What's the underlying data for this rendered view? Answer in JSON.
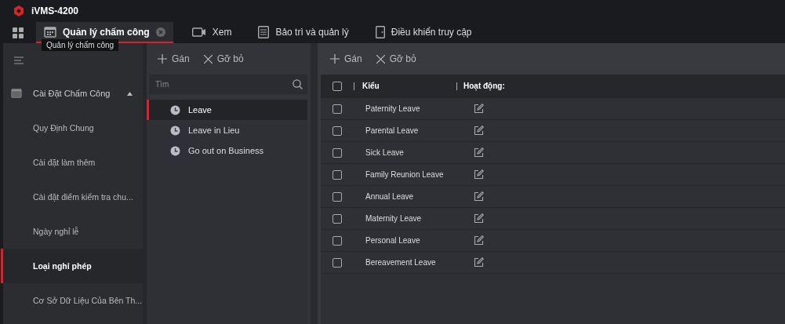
{
  "window": {
    "title": "iVMS-4200"
  },
  "tabs": [
    {
      "label": "Quản lý chấm công",
      "selected": true,
      "closable": true
    },
    {
      "label": "Xem",
      "selected": false,
      "closable": false
    },
    {
      "label": "Bảo trì và quản lý",
      "selected": false,
      "closable": false
    },
    {
      "label": "Điều khiển truy cập",
      "selected": false,
      "closable": false
    }
  ],
  "tooltip": "Quản lý chấm công",
  "sidebar": {
    "group": {
      "label": "Cài Đặt Chấm Công",
      "expanded": true,
      "children": [
        {
          "label": "Quy Định Chung",
          "selected": false
        },
        {
          "label": "Cài đặt làm thêm",
          "selected": false
        },
        {
          "label": "Cài đặt điểm kiểm tra chu...",
          "selected": false
        },
        {
          "label": "Ngày nghỉ lễ",
          "selected": false
        },
        {
          "label": "Loại nghỉ phép",
          "selected": true
        },
        {
          "label": "Cơ Sở Dữ Liệu Của Bên Th...",
          "selected": false
        }
      ]
    }
  },
  "middle_panel": {
    "toolbar": [
      "Gán",
      "Gỡ bỏ"
    ],
    "search": {
      "placeholder": "Tìm"
    },
    "items": [
      {
        "label": "Leave",
        "selected": true
      },
      {
        "label": "Leave in Lieu",
        "selected": false
      },
      {
        "label": "Go out on Business",
        "selected": false
      }
    ]
  },
  "right_panel": {
    "toolbar": [
      "Gán",
      "Gỡ bỏ"
    ],
    "table": {
      "columns": [
        "Kiểu",
        "Hoạt động:"
      ],
      "header_checked": false,
      "rows": [
        {
          "type": "Paternity Leave",
          "checked": false
        },
        {
          "type": "Parental Leave",
          "checked": false
        },
        {
          "type": "Sick Leave",
          "checked": false
        },
        {
          "type": "Family Reunion Leave",
          "checked": false
        },
        {
          "type": "Annual Leave",
          "checked": false
        },
        {
          "type": "Maternity Leave",
          "checked": false
        },
        {
          "type": "Personal Leave",
          "checked": false
        },
        {
          "type": "Bereavement Leave",
          "checked": false
        }
      ]
    }
  }
}
